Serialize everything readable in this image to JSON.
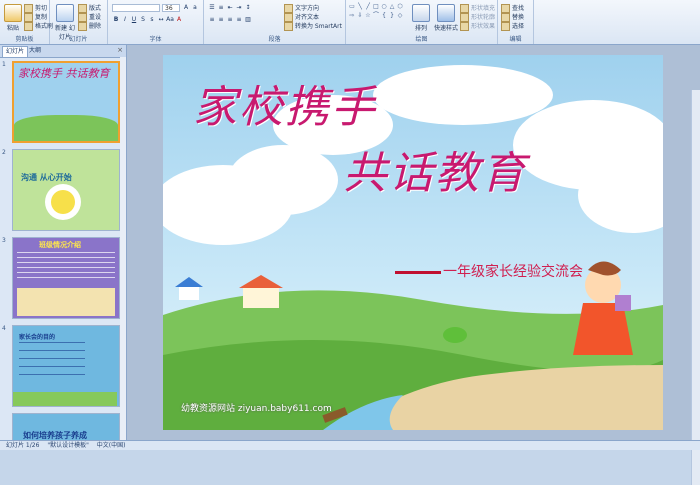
{
  "ribbon": {
    "clipboard": {
      "group": "剪贴板",
      "paste": "粘贴",
      "cut": "剪切",
      "copy": "复制",
      "painter": "格式刷"
    },
    "slides": {
      "group": "幻灯片",
      "new_slide": "新建\n幻灯片",
      "layout": "版式",
      "reset": "重设",
      "delete": "删除"
    },
    "font": {
      "group": "字体",
      "size": "36"
    },
    "paragraph": {
      "group": "段落",
      "text_dir": "文字方向",
      "align": "对齐文本",
      "smartart": "转换为 SmartArt"
    },
    "drawing": {
      "group": "绘图",
      "arrange": "排列",
      "styles": "快速样式",
      "fill": "形状填充",
      "outline": "形状轮廓",
      "effect": "形状效果"
    },
    "editing": {
      "group": "编辑",
      "find": "查找",
      "replace": "替换",
      "select": "选择"
    }
  },
  "panel": {
    "tab_slides": "幻灯片",
    "tab_outline": "大纲",
    "close": "×"
  },
  "thumbnails": [
    {
      "num": "1",
      "text": "家校携手 共话教育",
      "bg": "#9fd1ee"
    },
    {
      "num": "2",
      "text": "沟通  从心开始",
      "bg": "#bfe39a"
    },
    {
      "num": "3",
      "text": "班级情况介绍",
      "bg": "#8a74c9"
    },
    {
      "num": "4",
      "text": "家长会的目的",
      "bg": "#6fb8e0"
    },
    {
      "num": "5",
      "text": "如何培养孩子养成",
      "bg": "#6fb8e0"
    }
  ],
  "slide": {
    "title_line1": "家校携手",
    "title_line2": "共话教育",
    "subtitle": "一年级家长经验交流会",
    "watermark": "幼教资源网站 ziyuan.baby611.com"
  },
  "status": {
    "slide": "幻灯片 1/26",
    "theme": "\"默认设计模板\"",
    "lang": "中文(中国)"
  }
}
